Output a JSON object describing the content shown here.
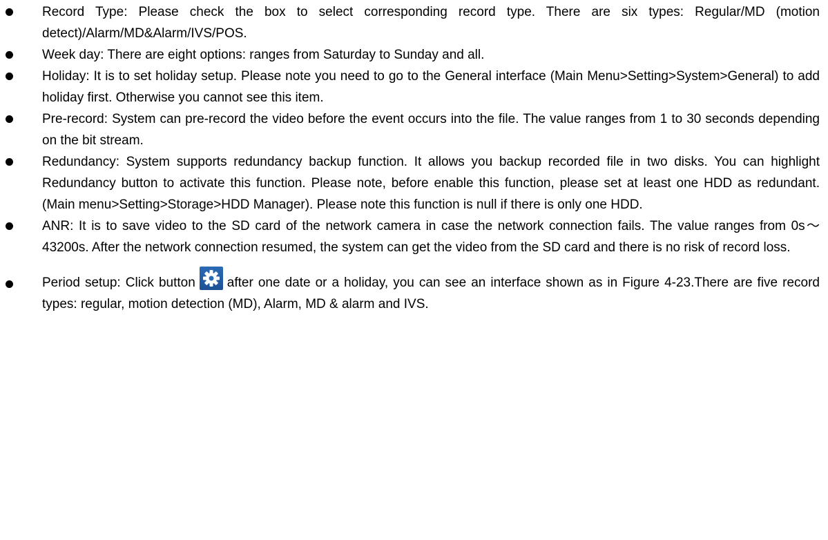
{
  "items": [
    {
      "text": "Record Type: Please check the box to select corresponding record type. There are six types: Regular/MD (motion detect)/Alarm/MD&Alarm/IVS/POS."
    },
    {
      "text": "Week day: There are eight options: ranges from Saturday to Sunday and all."
    },
    {
      "text": "Holiday: It is to set holiday setup. Please note you need to go to the General interface (Main Menu>Setting>System>General) to add holiday first. Otherwise you cannot see this item."
    },
    {
      "text": "Pre-record: System can pre-record the video before the event occurs into the file. The value ranges from 1 to 30 seconds depending on the bit stream."
    },
    {
      "text": "Redundancy: System supports redundancy backup function. It allows you backup recorded file in two disks. You can highlight Redundancy button to activate this function. Please note, before enable this function, please set at least one HDD as redundant. (Main menu>Setting>Storage>HDD Manager). Please note this function is null if there is only one HDD."
    },
    {
      "text": "ANR: It is to save video to the SD card of the network camera in case the network connection fails. The value ranges from 0s～43200s. After the network connection resumed, the system can get the video from the SD card and there is no risk of record loss."
    }
  ],
  "period_item": {
    "before": "Period setup: Click button",
    "after": "after one date or a holiday, you can see an interface shown as in Figure 4-23.There are five record types: regular, motion detection (MD), Alarm, MD & alarm and IVS.",
    "icon": "gear-icon"
  },
  "colors": {
    "gear_button_bg": "#2a6bb5",
    "gear": "#ffffff"
  }
}
